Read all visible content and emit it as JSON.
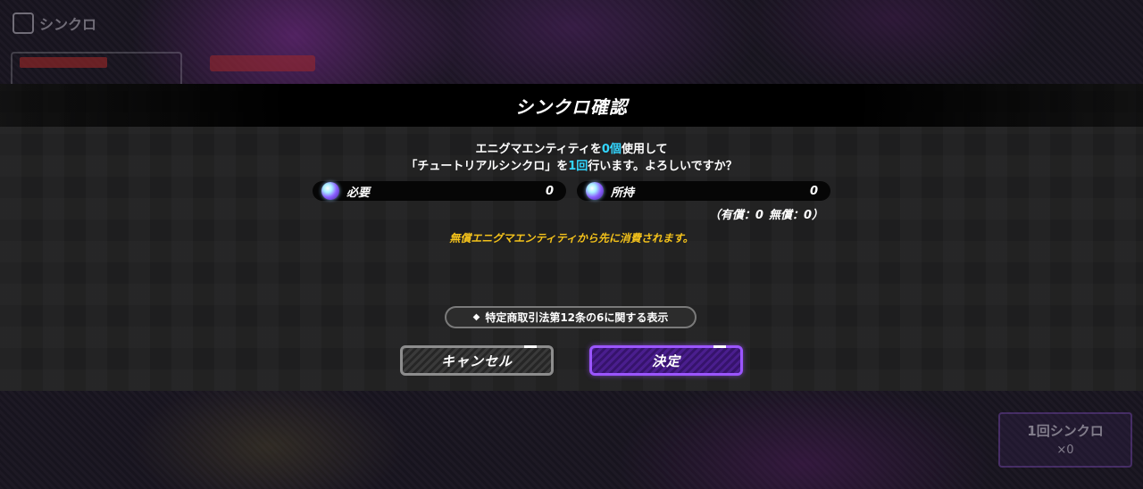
{
  "background": {
    "header_title": "シンクロ",
    "sync_button_label": "1回シンクロ",
    "sync_button_cost": "×0"
  },
  "dialog": {
    "title": "シンクロ確認",
    "message_line1": {
      "before": "エニグマエンティティを",
      "count": "0個",
      "after": "使用して"
    },
    "message_line2": {
      "before": "「チュートリアルシンクロ」を",
      "count": "1回",
      "after": "行います。よろしいですか？"
    },
    "required": {
      "label": "必要",
      "value": "0"
    },
    "owned": {
      "label": "所持",
      "value": "0"
    },
    "breakdown": {
      "paid": "（有償：0",
      "free": "無償：0）"
    },
    "note": "無償エニグマエンティティから先に消費されます。",
    "legal_link": {
      "icon": "◆",
      "label": "特定商取引法第12条の6に関する表示"
    },
    "cancel_label": "キャンセル",
    "confirm_label": "決定"
  },
  "colors": {
    "highlight": "#33d6ff",
    "note": "#f4c21b",
    "confirm_border": "#9b55ff"
  }
}
